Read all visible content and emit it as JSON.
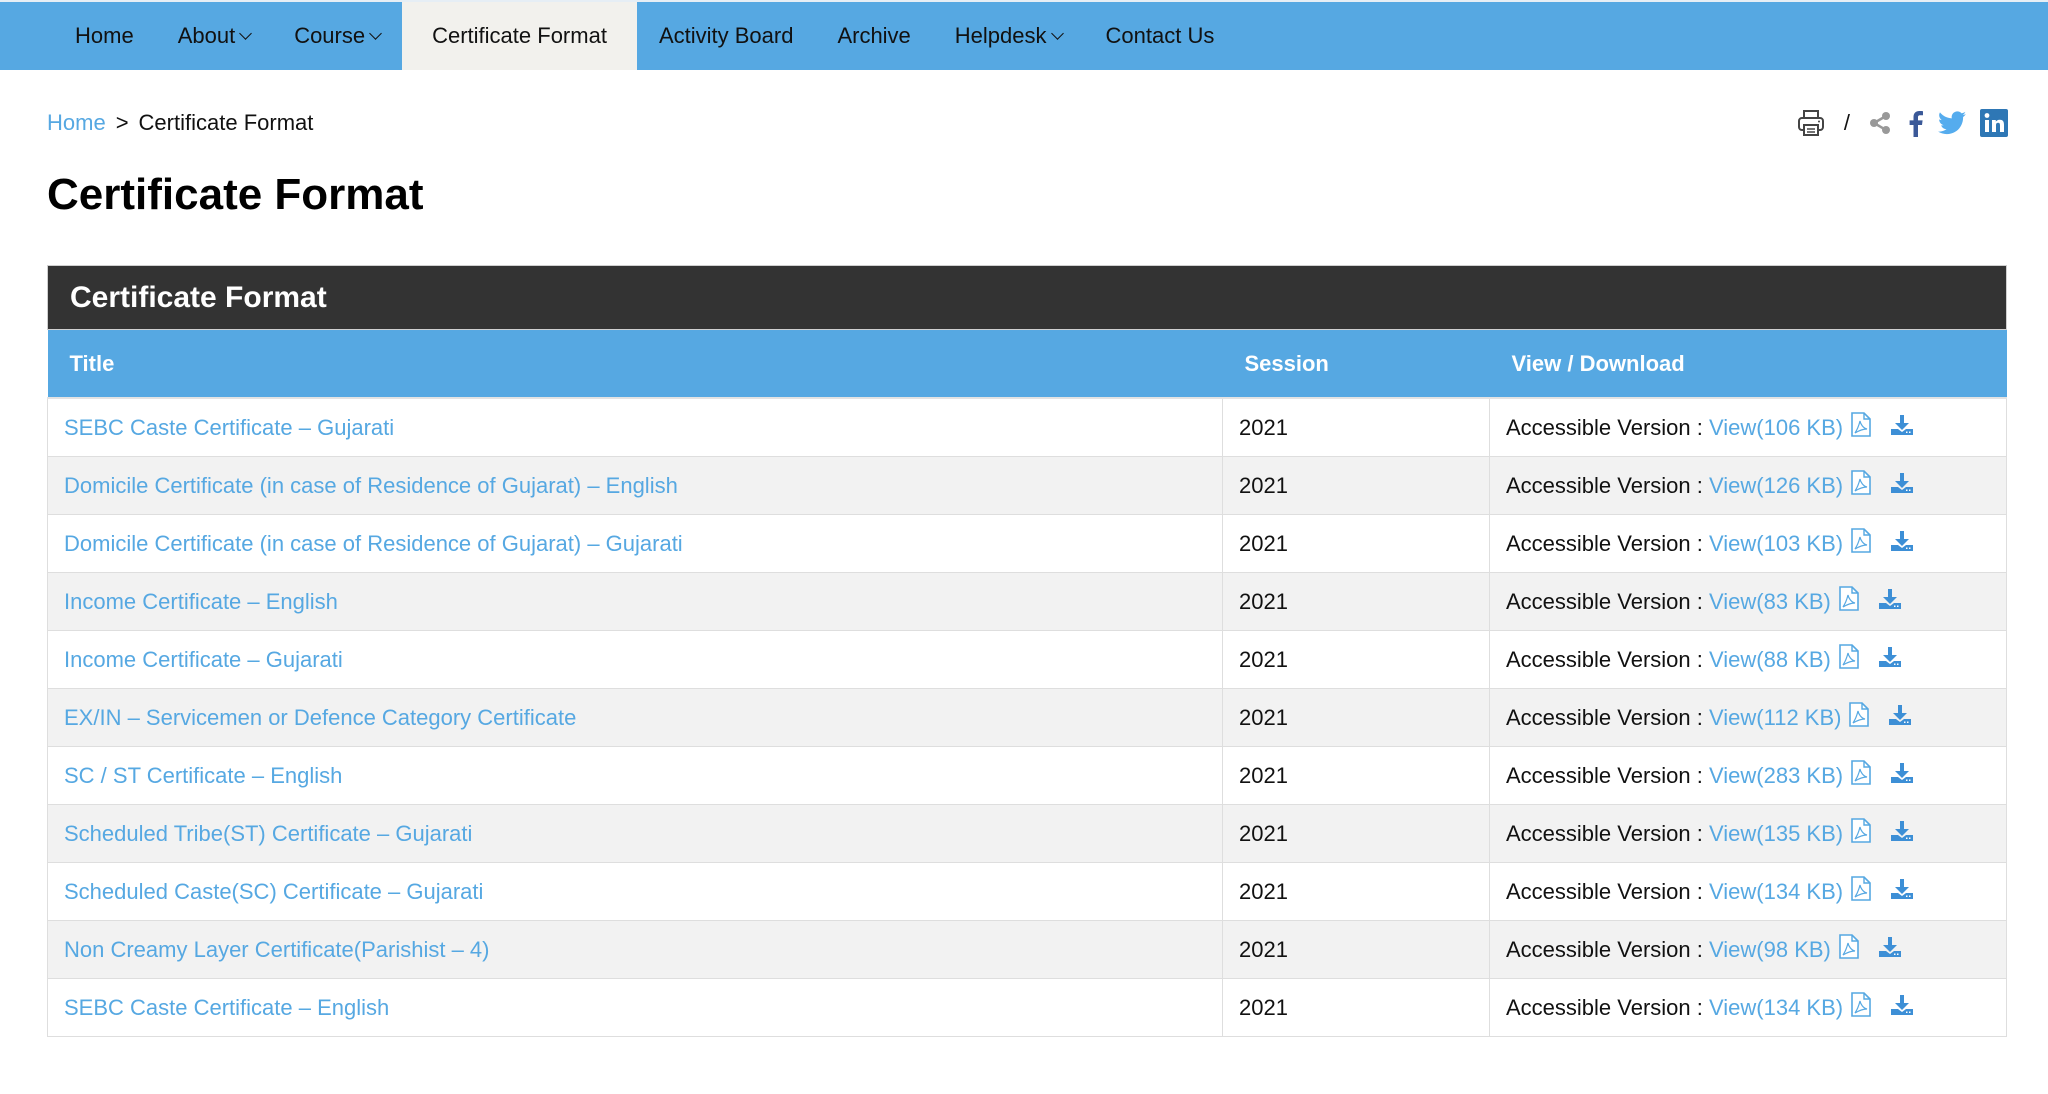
{
  "nav": {
    "items": [
      {
        "label": "Home",
        "dropdown": false,
        "active": false
      },
      {
        "label": "About",
        "dropdown": true,
        "active": false
      },
      {
        "label": "Course",
        "dropdown": true,
        "active": false
      },
      {
        "label": "Certificate Format",
        "dropdown": false,
        "active": true
      },
      {
        "label": "Activity Board",
        "dropdown": false,
        "active": false
      },
      {
        "label": "Archive",
        "dropdown": false,
        "active": false
      },
      {
        "label": "Helpdesk",
        "dropdown": true,
        "active": false
      },
      {
        "label": "Contact Us",
        "dropdown": false,
        "active": false
      }
    ]
  },
  "breadcrumb": {
    "home": "Home",
    "separator": ">",
    "current": "Certificate Format"
  },
  "share": {
    "separator": "/",
    "icons": [
      "print-icon",
      "share-icon",
      "facebook-icon",
      "twitter-icon",
      "linkedin-icon"
    ]
  },
  "colors": {
    "nav_bg": "#56a8e2",
    "active_tab_bg": "#f2f1ed",
    "caption_bg": "#333333",
    "link": "#56a8e2",
    "facebook": "#3b5998",
    "twitter": "#55acee",
    "linkedin": "#2e77b5"
  },
  "page": {
    "title": "Certificate Format"
  },
  "table": {
    "caption": "Certificate Format",
    "headers": [
      "Title",
      "Session",
      "View / Download"
    ],
    "accessible_label": "Accessible Version :",
    "rows": [
      {
        "title": "SEBC Caste Certificate – Gujarati",
        "session": "2021",
        "view": "View(106 KB)"
      },
      {
        "title": "Domicile Certificate (in case of Residence of Gujarat) – English",
        "session": "2021",
        "view": "View(126 KB)"
      },
      {
        "title": "Domicile Certificate (in case of Residence of Gujarat) – Gujarati",
        "session": "2021",
        "view": "View(103 KB)"
      },
      {
        "title": "Income Certificate – English",
        "session": "2021",
        "view": "View(83 KB)"
      },
      {
        "title": "Income Certificate – Gujarati",
        "session": "2021",
        "view": "View(88 KB)"
      },
      {
        "title": "EX/IN – Servicemen or Defence Category Certificate",
        "session": "2021",
        "view": "View(112 KB)"
      },
      {
        "title": "SC / ST Certificate – English",
        "session": "2021",
        "view": "View(283 KB)"
      },
      {
        "title": "Scheduled Tribe(ST) Certificate – Gujarati",
        "session": "2021",
        "view": "View(135 KB)"
      },
      {
        "title": "Scheduled Caste(SC) Certificate – Gujarati",
        "session": "2021",
        "view": "View(134 KB)"
      },
      {
        "title": "Non Creamy Layer Certificate(Parishist – 4)",
        "session": "2021",
        "view": "View(98 KB)"
      },
      {
        "title": "SEBC Caste Certificate – English",
        "session": "2021",
        "view": "View(134 KB)"
      }
    ]
  }
}
